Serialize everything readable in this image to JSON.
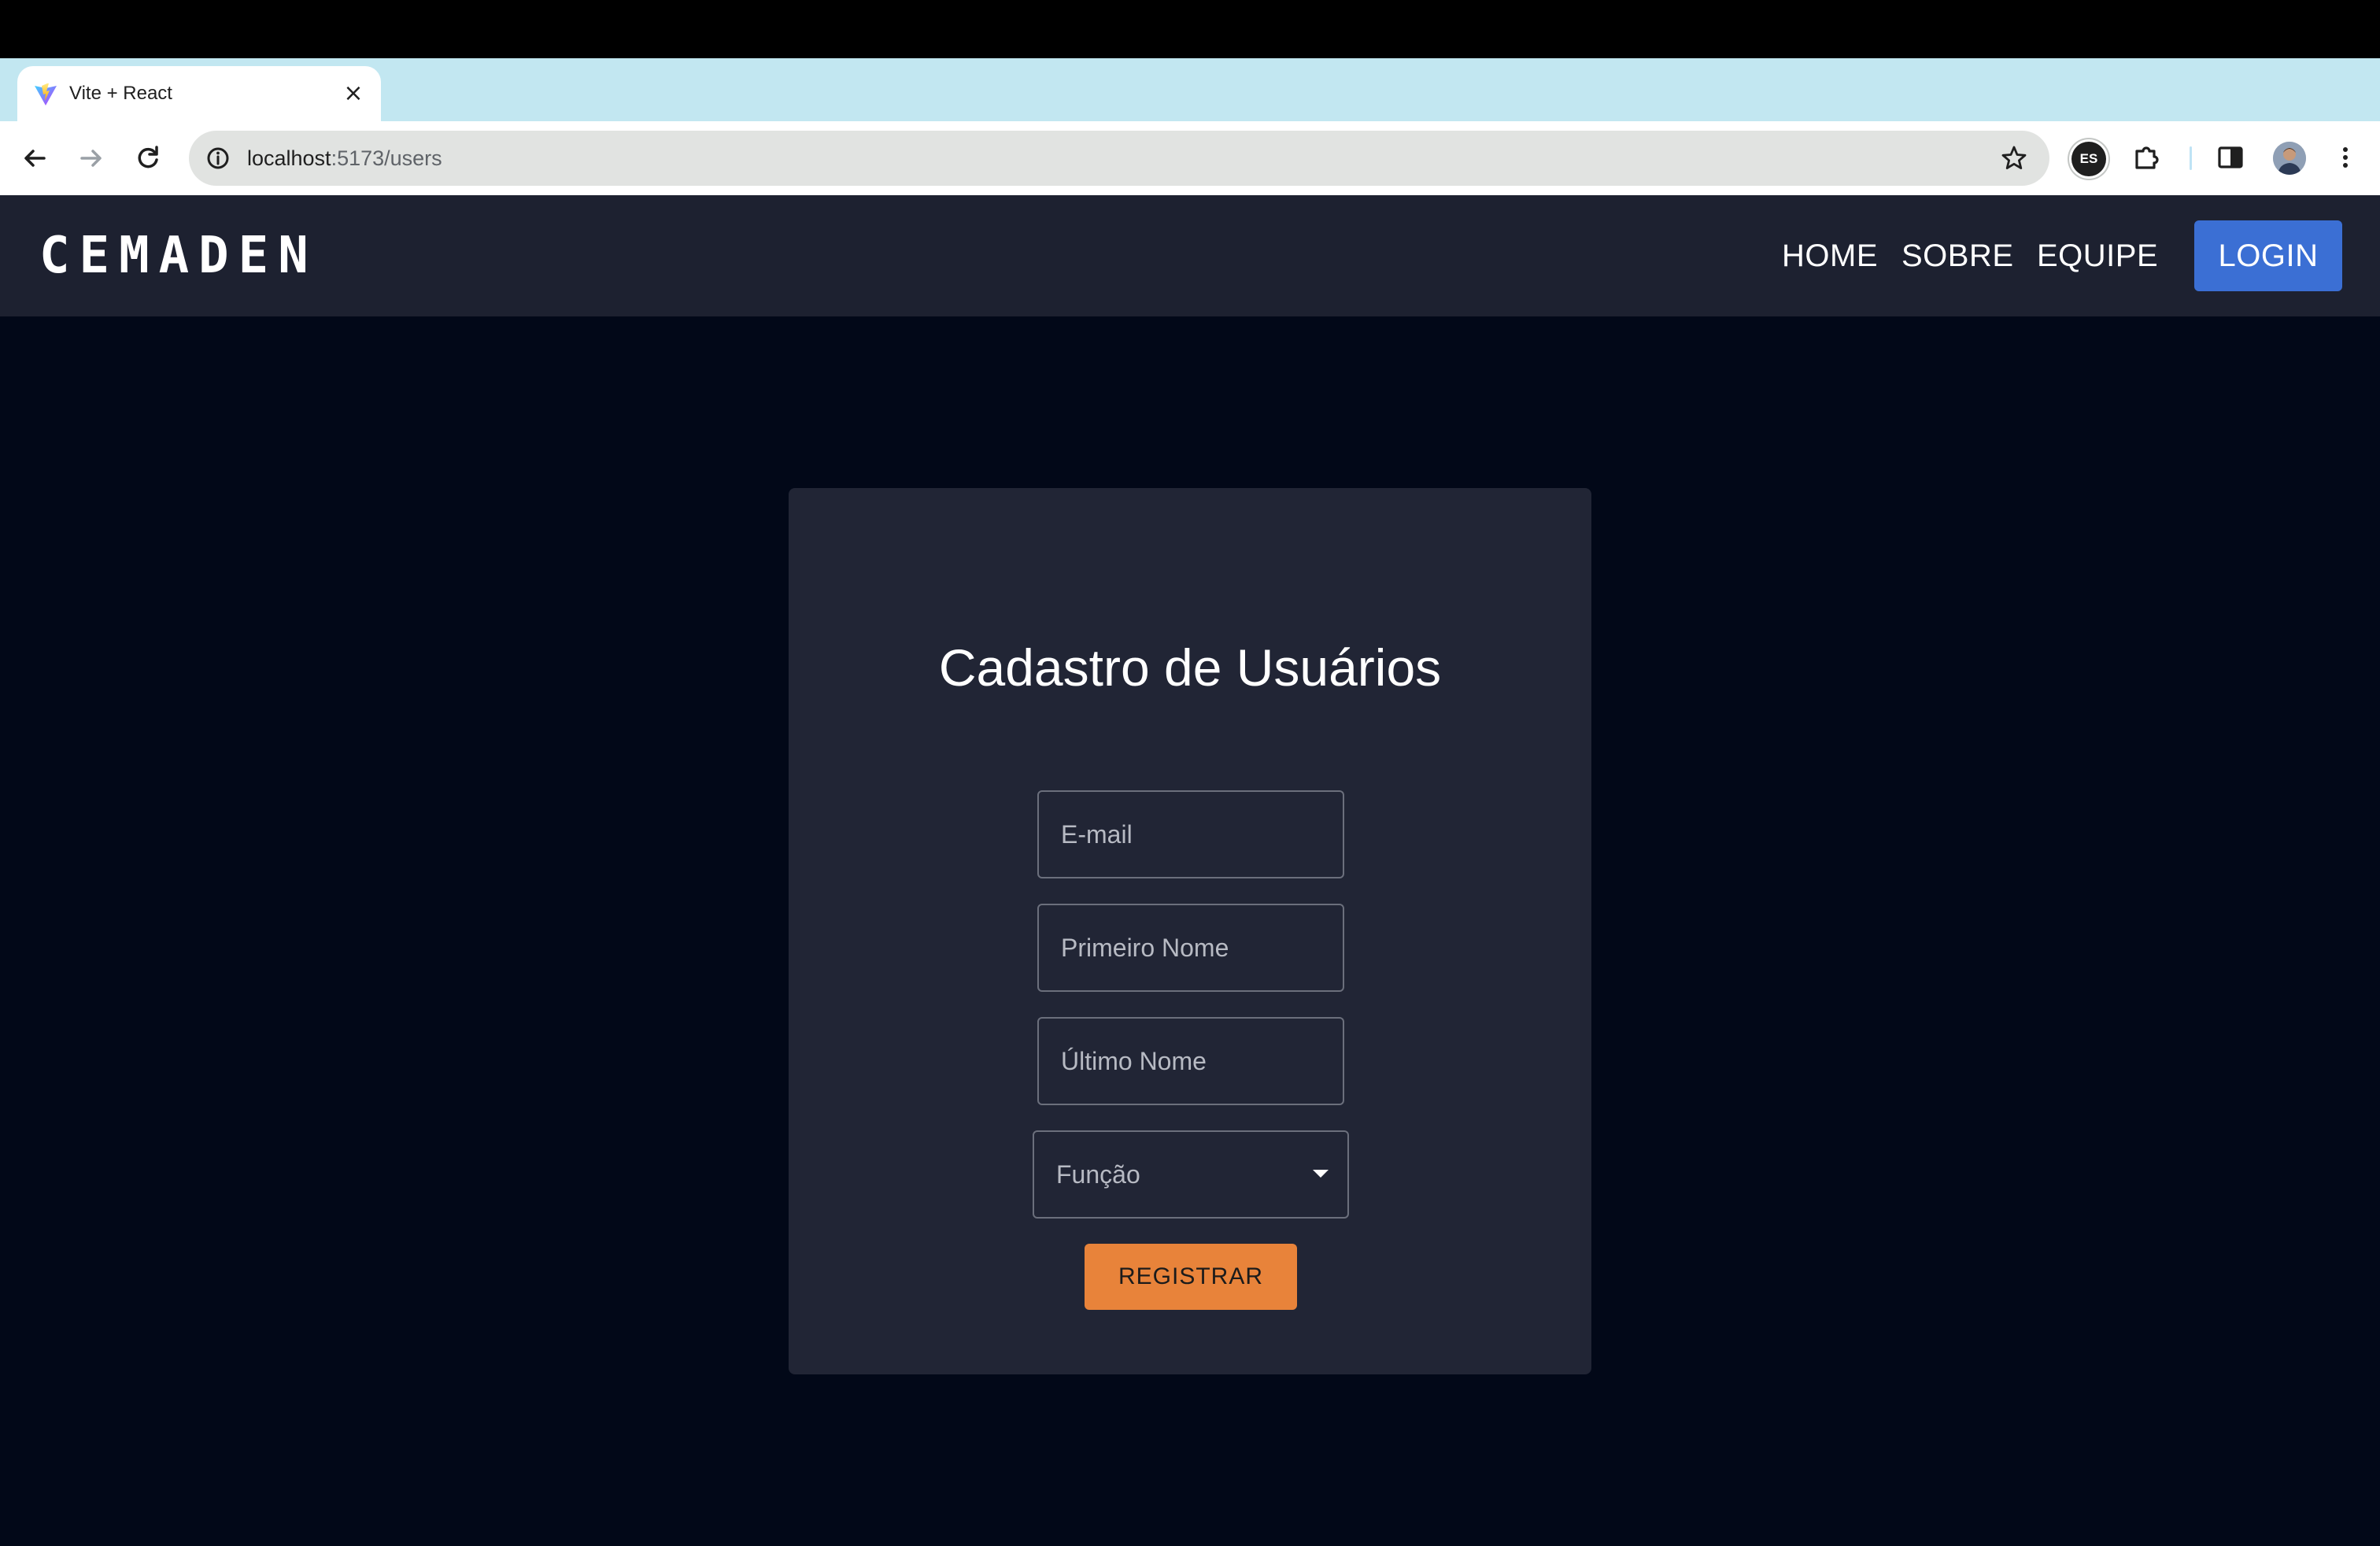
{
  "browser": {
    "tab": {
      "title": "Vite + React"
    },
    "omnibox": {
      "host": "localhost",
      "path": ":5173/users"
    },
    "extension_badge": "ES"
  },
  "navbar": {
    "brand": "CEMADEN",
    "links": [
      "HOME",
      "SOBRE",
      "EQUIPE"
    ],
    "login_label": "LOGIN",
    "login_color": "#3b6fd4"
  },
  "form": {
    "title": "Cadastro de Usuários",
    "email_placeholder": "E-mail",
    "first_name_placeholder": "Primeiro Nome",
    "last_name_placeholder": "Último Nome",
    "role_label": "Função",
    "submit_label": "REGISTRAR",
    "submit_color": "#e8833a"
  },
  "icons": {
    "tab_favicon": "vite-logo-icon",
    "tab_close": "close-icon",
    "new_tab": "plus-icon",
    "tab_search": "chevron-down-icon",
    "back": "arrow-left-icon",
    "forward": "arrow-right-icon",
    "reload": "reload-icon",
    "site_info": "info-icon",
    "bookmark": "star-icon",
    "extensions": "puzzle-icon",
    "side_panel": "side-panel-icon",
    "profile": "avatar",
    "menu": "kebab-menu-icon",
    "select_caret": "caret-down-icon"
  }
}
